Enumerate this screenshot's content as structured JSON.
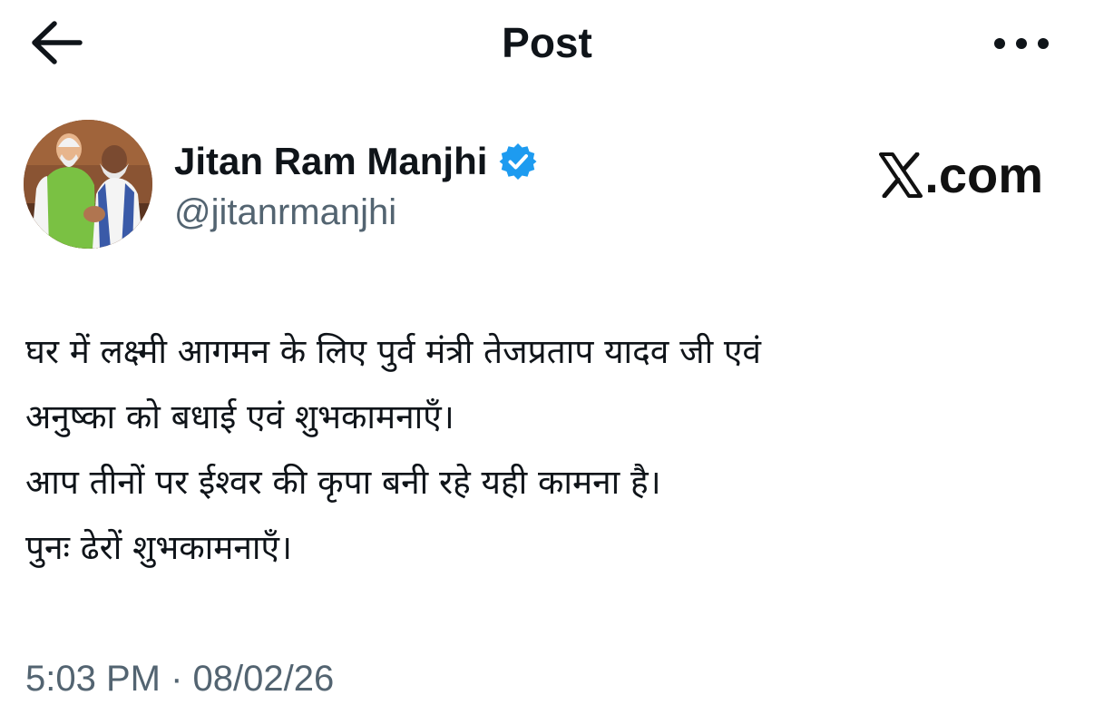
{
  "header": {
    "title": "Post",
    "back_icon": "arrow-left-icon",
    "more_icon": "ellipsis-horizontal-icon"
  },
  "author": {
    "display_name": "Jitan Ram Manjhi",
    "handle": "@jitanrmanjhi",
    "verified": true,
    "verified_color": "#1d9bf0"
  },
  "watermark": {
    "text": ".com",
    "logo_icon": "x-logo-icon"
  },
  "tweet": {
    "lines": [
      "घर में लक्ष्मी आगमन के लिए पुर्व मंत्री तेजप्रताप यादव जी एवं",
      "अनुष्का को बधाई एवं शुभकामनाएँ।",
      "आप तीनों पर ईश्वर की कृपा बनी रहे यही कामना है।",
      "पुनः ढेरों शुभकामनाएँ।"
    ]
  },
  "meta": {
    "timestamp": "5:03 PM · 08/02/26"
  },
  "colors": {
    "text_primary": "#0f1419",
    "text_secondary": "#536471",
    "background": "#ffffff"
  }
}
